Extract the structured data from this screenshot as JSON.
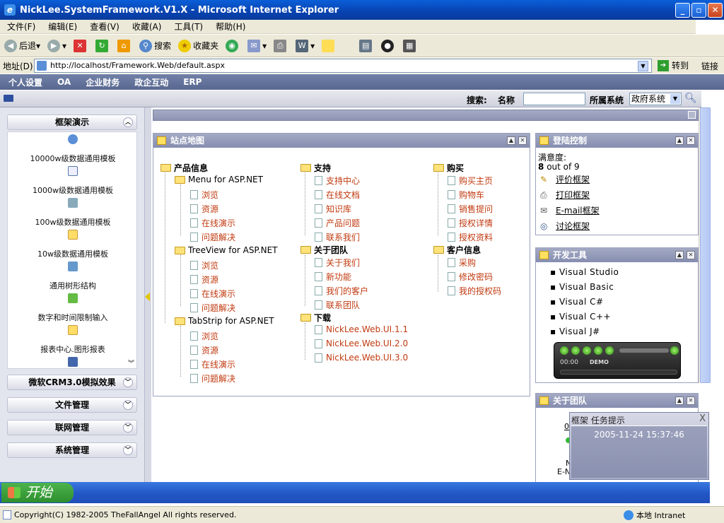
{
  "window": {
    "title": "NickLee.SystemFramework.V1.X - Microsoft Internet Explorer"
  },
  "menubar": [
    "文件(F)",
    "编辑(E)",
    "查看(V)",
    "收藏(A)",
    "工具(T)",
    "帮助(H)"
  ],
  "toolbar": {
    "back": "后退",
    "search": "搜索",
    "favorites": "收藏夹"
  },
  "address": {
    "label": "地址(D)",
    "url": "http://localhost/Framework.Web/default.aspx",
    "go": "转到",
    "links": "链接"
  },
  "appnav": [
    "个人设置",
    "OA",
    "企业财务",
    "政企互动",
    "ERP"
  ],
  "search": {
    "label": "搜索:",
    "name_label": "名称",
    "name_value": "",
    "system_label": "所属系统",
    "system_value": "政府系统"
  },
  "sidebar": {
    "panels": [
      "框架演示",
      "微软CRM3.0模拟效果",
      "文件管理",
      "联网管理",
      "系统管理"
    ],
    "items": [
      "10000w级数据通用模板",
      "1000w级数据通用模板",
      "100w级数据通用模板",
      "10w级数据通用模板",
      "通用树形结构",
      "数字和时间限制输入",
      "报表中心.图形报表"
    ]
  },
  "sitemap": {
    "title": "站点地图",
    "col1": {
      "root": "产品信息",
      "groups": [
        {
          "name": "Menu for ASP.NET",
          "items": [
            "浏览",
            "资源",
            "在线演示",
            "问题解决"
          ]
        },
        {
          "name": "TreeView for ASP.NET",
          "items": [
            "浏览",
            "资源",
            "在线演示",
            "问题解决"
          ]
        },
        {
          "name": "TabStrip for ASP.NET",
          "items": [
            "浏览",
            "资源",
            "在线演示",
            "问题解决"
          ]
        }
      ]
    },
    "col2": [
      {
        "name": "支持",
        "items": [
          "支持中心",
          "在线文档",
          "知识库",
          "产品问题",
          "联系我们"
        ]
      },
      {
        "name": "关于团队",
        "items": [
          "关于我们",
          "新功能",
          "我们的客户",
          "联系团队"
        ]
      },
      {
        "name": "下载",
        "items": [
          "NickLee.Web.UI.1.1",
          "NickLee.Web.UI.2.0",
          "NickLee.Web.UI.3.0"
        ]
      }
    ],
    "col3": [
      {
        "name": "购买",
        "items": [
          "购买主页",
          "购物车",
          "销售提问",
          "授权详情",
          "授权资料"
        ]
      },
      {
        "name": "客户信息",
        "items": [
          "采购",
          "修改密码",
          "我的授权码"
        ]
      }
    ]
  },
  "login": {
    "title": "登陆控制",
    "satisfaction_label": "满意度:",
    "rating_value": "8",
    "rating_rest": "out of 9",
    "links": [
      "评价框架",
      "打印框架",
      "E-mail框架",
      "讨论框架"
    ]
  },
  "devtools": {
    "title": "开发工具",
    "items": [
      "Visual Studio",
      "Visual Basic",
      "Visual C#",
      "Visual C++",
      "Visual J#"
    ],
    "player": {
      "time": "00:00",
      "label": "DEMO"
    }
  },
  "team": {
    "title": "关于团队",
    "lines": [
      "0",
      "N",
      "E-N"
    ]
  },
  "popup": {
    "title": "框架 任务提示",
    "close": "X",
    "datetime": "2005-11-24 15:37:46"
  },
  "taskbar": {
    "start": "开始"
  },
  "status": {
    "text": "Copyright(C)    1982-2005 TheFallAngel All rights reserved.",
    "zone": "本地 Intranet"
  }
}
